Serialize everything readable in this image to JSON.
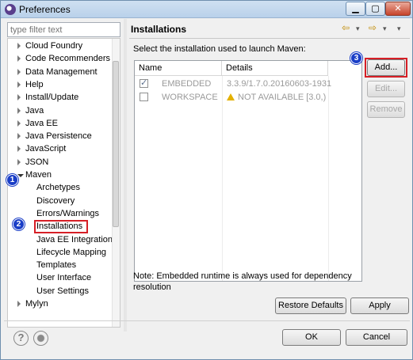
{
  "window": {
    "title": "Preferences"
  },
  "filter": {
    "placeholder": "type filter text"
  },
  "tree": {
    "items": [
      {
        "label": "Cloud Foundry",
        "expandable": true,
        "expanded": false,
        "level": 0
      },
      {
        "label": "Code Recommenders",
        "expandable": true,
        "expanded": false,
        "level": 0
      },
      {
        "label": "Data Management",
        "expandable": true,
        "expanded": false,
        "level": 0
      },
      {
        "label": "Help",
        "expandable": true,
        "expanded": false,
        "level": 0
      },
      {
        "label": "Install/Update",
        "expandable": true,
        "expanded": false,
        "level": 0
      },
      {
        "label": "Java",
        "expandable": true,
        "expanded": false,
        "level": 0
      },
      {
        "label": "Java EE",
        "expandable": true,
        "expanded": false,
        "level": 0
      },
      {
        "label": "Java Persistence",
        "expandable": true,
        "expanded": false,
        "level": 0
      },
      {
        "label": "JavaScript",
        "expandable": true,
        "expanded": false,
        "level": 0
      },
      {
        "label": "JSON",
        "expandable": true,
        "expanded": false,
        "level": 0
      },
      {
        "label": "Maven",
        "expandable": true,
        "expanded": true,
        "level": 0
      },
      {
        "label": "Archetypes",
        "expandable": false,
        "level": 1
      },
      {
        "label": "Discovery",
        "expandable": false,
        "level": 1
      },
      {
        "label": "Errors/Warnings",
        "expandable": false,
        "level": 1
      },
      {
        "label": "Installations",
        "expandable": false,
        "level": 1,
        "selected": true
      },
      {
        "label": "Java EE Integration",
        "expandable": false,
        "level": 1
      },
      {
        "label": "Lifecycle Mapping",
        "expandable": false,
        "level": 1
      },
      {
        "label": "Templates",
        "expandable": false,
        "level": 1
      },
      {
        "label": "User Interface",
        "expandable": false,
        "level": 1
      },
      {
        "label": "User Settings",
        "expandable": false,
        "level": 1
      },
      {
        "label": "Mylyn",
        "expandable": true,
        "expanded": false,
        "level": 0
      }
    ]
  },
  "page": {
    "title": "Installations",
    "instruction": "Select the installation used to launch Maven:",
    "table": {
      "columns": [
        "Name",
        "Details"
      ],
      "rows": [
        {
          "checked": true,
          "name": "EMBEDDED",
          "details": "3.3.9/1.7.0.20160603-1931",
          "warning": false
        },
        {
          "checked": false,
          "name": "WORKSPACE",
          "details": "NOT AVAILABLE [3.0,)",
          "warning": true
        }
      ]
    },
    "buttons": {
      "add": "Add...",
      "edit": "Edit...",
      "remove": "Remove"
    },
    "note": "Note: Embedded runtime is always used for dependency resolution",
    "restore_defaults": "Restore Defaults",
    "apply": "Apply"
  },
  "footer": {
    "ok": "OK",
    "cancel": "Cancel"
  },
  "annotations": {
    "badge1": "1",
    "badge2": "2",
    "badge3": "3"
  },
  "colors": {
    "highlight": "#d61f26",
    "badge": "#1a3ec7"
  }
}
